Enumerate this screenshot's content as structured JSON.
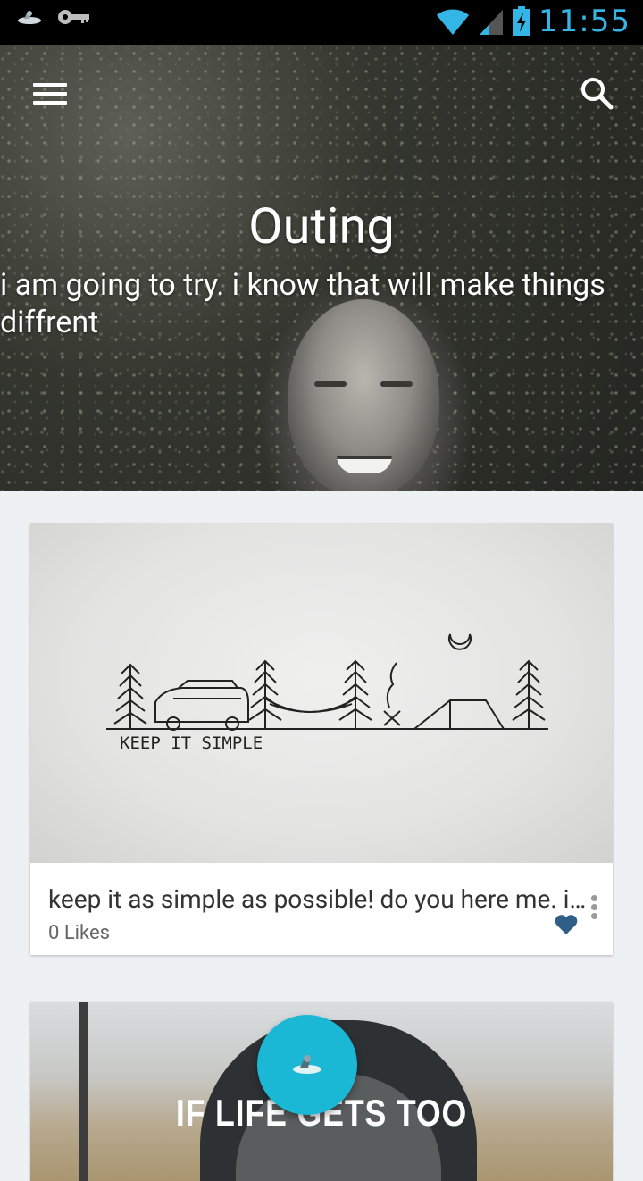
{
  "status_bar": {
    "time": "11:55",
    "icons": [
      "app-notification-icon",
      "vpn-key-icon",
      "wifi-icon",
      "cell-signal-icon",
      "battery-charging-icon"
    ]
  },
  "header": {
    "title": "Outing",
    "subtitle": "i am going to try. i know that will make things diffrent",
    "menu_icon": "hamburger-menu-icon",
    "search_icon": "search-icon"
  },
  "posts": [
    {
      "image_text": "KEEP IT SIMPLE",
      "text": "keep it as simple as possible! do you here me. it simple",
      "likes": "0 Likes",
      "like_icon": "heart-icon",
      "menu_icon": "more-vert-icon"
    },
    {
      "image_text": "IF LIFE GETS TOO"
    }
  ],
  "fab": {
    "icon": "app-logo-icon"
  },
  "colors": {
    "status_icon": "#33b5e5",
    "fab": "#1ab8d4",
    "heart": "#2f5f86",
    "background": "#eef1f4"
  }
}
